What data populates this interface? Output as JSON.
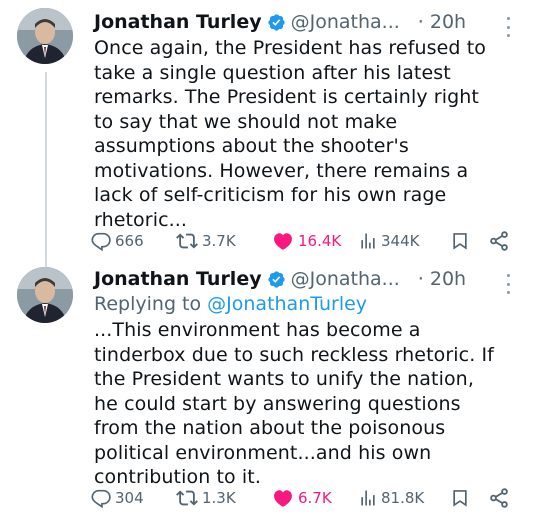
{
  "tweets": [
    {
      "name": "Jonathan Turley",
      "handle": "@Jonatha...",
      "time": "· 20h",
      "text": "Once again, the President has refused to\ntake a single question after his latest\nremarks. The President is certainly right\nto say that we should not make\nassumptions about the shooter's\nmotivations. However, there remains a\nlack of self-criticism for his own rage\nrhetoric...",
      "replies": "666",
      "reposts": "3.7K",
      "likes": "16.4K",
      "views": "344K"
    },
    {
      "name": "Jonathan Turley",
      "handle": "@Jonatha...",
      "time": "· 20h",
      "replying_prefix": "Replying to ",
      "replying_to": "@JonathanTurley",
      "text": "...This environment has become a\ntinderbox due to such reckless rhetoric. If\nthe President wants to unify the nation,\nhe could start by answering questions\nfrom the nation about the poisonous\npolitical environment...and his own\ncontribution to it.",
      "replies": "304",
      "reposts": "1.3K",
      "likes": "6.7K",
      "views": "81.8K"
    }
  ],
  "icons": {
    "verified": "verified-badge-icon",
    "reply": "reply-icon",
    "repost": "repost-icon",
    "like": "heart-icon",
    "views": "views-chart-icon",
    "bookmark": "bookmark-icon",
    "share": "share-icon"
  },
  "colors": {
    "verified": "#1d9bf0",
    "like": "#f91880",
    "secondary_text": "#536471",
    "mention": "#1d9bf0"
  }
}
